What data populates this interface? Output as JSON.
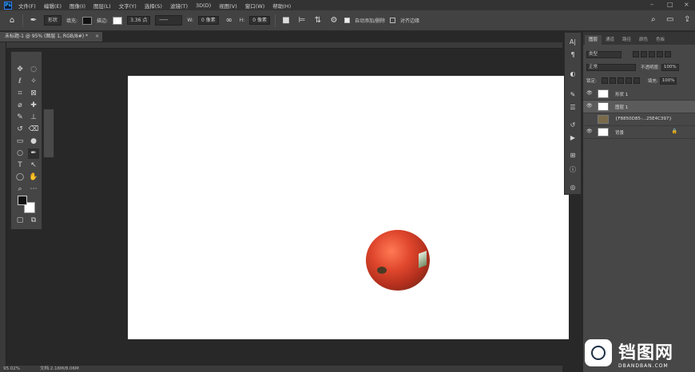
{
  "menubar": {
    "logo": "Ps",
    "items": [
      "文件(F)",
      "编辑(E)",
      "图像(I)",
      "图层(L)",
      "文字(Y)",
      "选择(S)",
      "滤镜(T)",
      "3D(D)",
      "视图(V)",
      "窗口(W)",
      "帮助(H)"
    ]
  },
  "options": {
    "mode": "形状",
    "fill_label": "填充:",
    "stroke_label": "描边:",
    "stroke_width": "3.36 点",
    "w_label": "W:",
    "w_value": "0 像素",
    "h_label": "H:",
    "h_value": "0 像素",
    "auto_add_delete": "自动添加/删除",
    "align_edges": "对齐边缘"
  },
  "document": {
    "tab_title": "未标题-1 @ 95% (图层 1, RGB/8#) *",
    "zoom": "95.02%",
    "doc_info": "文档:2.16M/8.06M"
  },
  "layers_panel": {
    "tabs": [
      "图层",
      "通道",
      "路径",
      "颜色",
      "色板"
    ],
    "filter_type": "类型",
    "blend_mode": "正常",
    "opacity_label": "不透明度:",
    "opacity_value": "100%",
    "lock_label": "锁定:",
    "fill_label": "填充:",
    "fill_value": "100%",
    "layers": [
      {
        "name": "形状 1"
      },
      {
        "name": "图层 1"
      },
      {
        "name": "{F8850D85-...25E4C397}"
      },
      {
        "name": "背景"
      }
    ]
  },
  "watermark": {
    "brand": "铛图网",
    "brand_sub": "DBANDBAN.COM"
  },
  "colors": {
    "foreground": "#111111",
    "background": "#ffffff",
    "canvas": "#ffffff"
  }
}
